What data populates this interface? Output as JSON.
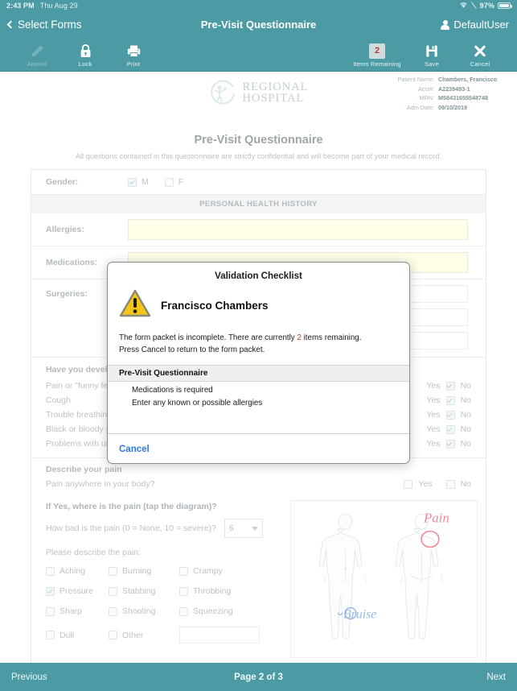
{
  "statusbar": {
    "time": "2:43 PM",
    "date": "Thu Aug 29",
    "battery_percent": "97%",
    "wifi_icon": "wifi-icon",
    "battery_icon": "battery-icon"
  },
  "navbar": {
    "back_label": "Select Forms",
    "title": "Pre-Visit Questionnaire",
    "user_label": "DefaultUser"
  },
  "toolbar": {
    "left_items": [
      {
        "label": "Amend",
        "icon": "pencil-icon",
        "disabled": true
      },
      {
        "label": "Lock",
        "icon": "lock-icon",
        "disabled": false
      },
      {
        "label": "Print",
        "icon": "printer-icon",
        "disabled": false
      }
    ],
    "right_items": [
      {
        "label": "Items Remaining",
        "icon": "badge-count",
        "count": "2"
      },
      {
        "label": "Save",
        "icon": "floppy-disk-icon"
      },
      {
        "label": "Cancel",
        "icon": "close-x-icon"
      }
    ]
  },
  "patient_header": {
    "logo_line1": "REGIONAL",
    "logo_line2": "HOSPITAL",
    "fields": [
      {
        "label": "Patient Name:",
        "value": "Chambers, Francisco"
      },
      {
        "label": "Acct#:",
        "value": "A2239493-1"
      },
      {
        "label": "MRN:",
        "value": "M58431655548748"
      },
      {
        "label": "Adm Date:",
        "value": "09/10/2019"
      }
    ]
  },
  "form": {
    "title": "Pre-Visit Questionnaire",
    "subtitle": "All questions contained in this questionnaire are strictly confidential and will become part of your medical record.",
    "gender": {
      "label": "Gender:",
      "options": [
        {
          "label": "M",
          "checked": true
        },
        {
          "label": "F",
          "checked": false
        }
      ]
    },
    "section_header": "PERSONAL HEALTH HISTORY",
    "fields": [
      {
        "label": "Allergies:",
        "value": "",
        "required": true
      },
      {
        "label": "Medications:",
        "value": "",
        "required": true
      },
      {
        "label": "Surgeries:",
        "value": "",
        "required": false
      }
    ],
    "symptoms_header": "Have you developed any of the following?",
    "symptoms": [
      {
        "label": "Pain or \"funny feeling\" in the chest",
        "yes": "Yes",
        "no": "No",
        "answer": "No"
      },
      {
        "label": "Cough",
        "yes": "Yes",
        "no": "No",
        "answer": "No"
      },
      {
        "label": "Trouble breathing",
        "yes": "Yes",
        "no": "No",
        "answer": "No"
      },
      {
        "label": "Black or bloody stools",
        "yes": "Yes",
        "no": "No",
        "answer": "No"
      },
      {
        "label": "Problems with urination",
        "yes": "Yes",
        "no": "No",
        "answer": "No"
      }
    ],
    "pain": {
      "section_label": "Describe your pain",
      "anywhere_question": "Pain anywhere in your body?",
      "anywhere_yes": "Yes",
      "anywhere_no": "No",
      "diagram_question": "If Yes, where is the pain (tap the diagram)?",
      "severity_question": "How bad is the pain (0 = None, 10 = severe)?",
      "severity_value": "6",
      "describe_label": "Please describe the pain:",
      "descriptors": [
        {
          "label": "Aching",
          "checked": false
        },
        {
          "label": "Burning",
          "checked": false
        },
        {
          "label": "Crampy",
          "checked": false
        },
        {
          "label": "Pressure",
          "checked": true
        },
        {
          "label": "Stabbing",
          "checked": false
        },
        {
          "label": "Throbbing",
          "checked": false
        },
        {
          "label": "Sharp",
          "checked": false
        },
        {
          "label": "Shooting",
          "checked": false
        },
        {
          "label": "Squeezing",
          "checked": false
        },
        {
          "label": "Dull",
          "checked": false
        },
        {
          "label": "Other",
          "checked": false
        }
      ],
      "other_value": "",
      "diagram_annotations": [
        {
          "text": "Pain",
          "color": "#f2889c"
        },
        {
          "text": "Bruise",
          "color": "#9bb8e0"
        }
      ]
    }
  },
  "modal": {
    "title": "Validation Checklist",
    "warning_icon": "warning-triangle-icon",
    "patient_name": "Francisco Chambers",
    "message_before_count": "The form packet is incomplete. There are currently ",
    "count": "2",
    "message_after_count": " items remaining.",
    "message_line2": "Press Cancel to return to the form packet.",
    "list_header": "Pre-Visit Questionnaire",
    "list_items": [
      "Medications is required",
      "Enter any known or possible allergies"
    ],
    "cancel_label": "Cancel"
  },
  "bottombar": {
    "previous_label": "Previous",
    "page_label": "Page 2 of 3",
    "next_label": "Next"
  },
  "colors": {
    "teal": "#4c9ba4",
    "required_yellow": "#fdfde8",
    "alert_red": "#c0392b",
    "link_blue": "#2a7ae2",
    "warning_yellow": "#f5c518"
  }
}
